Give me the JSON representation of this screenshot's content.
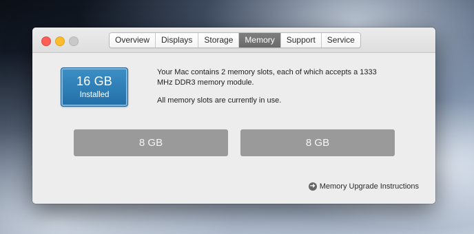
{
  "window": {
    "tabs": [
      "Overview",
      "Displays",
      "Storage",
      "Memory",
      "Support",
      "Service"
    ],
    "active_tab": "Memory"
  },
  "memory": {
    "installed_size": "16 GB",
    "installed_label": "Installed",
    "description": "Your Mac contains 2 memory slots, each of which accepts a 1333 MHz DDR3 memory module.",
    "status": "All memory slots are currently in use.",
    "slots": [
      "8 GB",
      "8 GB"
    ],
    "upgrade_link": "Memory Upgrade Instructions"
  },
  "icons": {
    "upgrade_link_icon": "arrow-circle-right-icon"
  },
  "colors": {
    "close": "#fc5f57",
    "minimize": "#fdbc2e",
    "zoom_disabled": "#c9c9c9",
    "installed_badge": "#2f80bb",
    "slot": "#9a9a9a",
    "active_tab": "#757575"
  }
}
